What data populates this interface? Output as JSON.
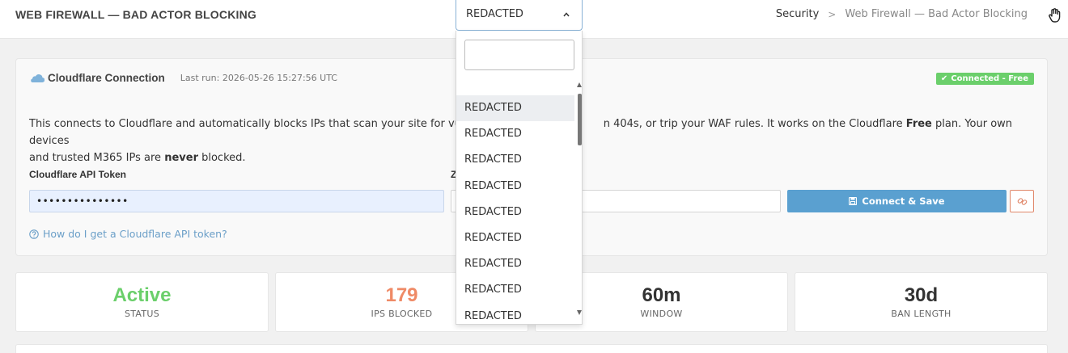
{
  "header": {
    "page_title": "WEB FIREWALL — BAD ACTOR BLOCKING",
    "breadcrumb": {
      "parent": "Security",
      "separator": ">",
      "current": "Web Firewall — Bad Actor Blocking"
    }
  },
  "site_select": {
    "selected": "REDACTED",
    "search_value": "",
    "options": [
      "REDACTED",
      "REDACTED",
      "REDACTED",
      "REDACTED",
      "REDACTED",
      "REDACTED",
      "REDACTED",
      "REDACTED",
      "REDACTED"
    ]
  },
  "connection": {
    "title": "Cloudflare Connection",
    "last_run": "Last run: 2026-05-26 15:27:56 UTC",
    "status_badge": "Connected - Free",
    "desc_part1": "This connects to Cloudflare and automatically blocks IPs that scan your site for vulne",
    "desc_part2": "n 404s, or trip your WAF rules. It works on the Cloudflare ",
    "desc_bold1": "Free",
    "desc_part3": " plan. Your own devices",
    "desc_part4": "and trusted M365 IPs are ",
    "desc_bold2": "never",
    "desc_part5": " blocked.",
    "token_label": "Cloudflare API Token",
    "token_value": "•••••••••••••••",
    "zone_label": "Z",
    "zone_value": "",
    "connect_button": "Connect & Save",
    "help_link": "How do I get a Cloudflare API token?"
  },
  "stats": [
    {
      "value": "Active",
      "label": "STATUS"
    },
    {
      "value": "179",
      "label": "IPS BLOCKED"
    },
    {
      "value": "60m",
      "label": "WINDOW"
    },
    {
      "value": "30d",
      "label": "BAN LENGTH"
    }
  ],
  "colors": {
    "active_green": "#6bcf6b",
    "blocked_orange": "#ef8a66",
    "primary_blue": "#5aa0d0",
    "danger_outline": "#e0876a"
  }
}
